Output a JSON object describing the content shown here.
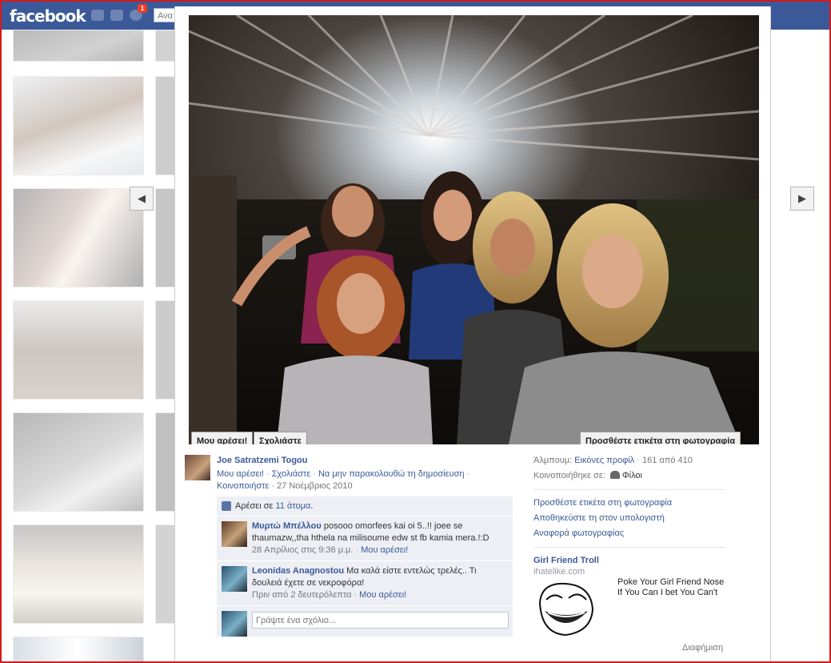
{
  "topbar": {
    "logo": "facebook",
    "notification_count": "1",
    "search_placeholder": "Ανα"
  },
  "photo": {
    "like_button": "Μου αρέσει!",
    "comment_button": "Σχολιάστε",
    "tag_button": "Προσθέστε ετικέτα στη φωτογραφία"
  },
  "post": {
    "owner_name": "Joe Satratzemi Togou",
    "actions": [
      "Μου αρέσει!",
      "Σχολιάστε",
      "Να μην παρακολουθώ τη δημοσίευση",
      "Κοινοποιήστε"
    ],
    "date": "27 Νοέμβριος 2010",
    "likes_prefix": "Αρέσει σε",
    "likes_link": "11 άτομα",
    "likes_suffix": ".",
    "comments": [
      {
        "author": "Μυρτώ Μπέλλου",
        "text": "posooo omorfees kai oi 5..!! joee se thaumazw,,tha hthela na milisoume edw st fb kamia mera.!:D",
        "time": "28 Απρίλιος στις 9:36 μ.μ.",
        "like": "Μου αρέσει!"
      },
      {
        "author": "Leonidas Anagnostou",
        "text": "Μα καλά είστε εντελώς τρελές.. Τι δουλειά έχετε σε νεκροφόρα!",
        "time": "Πριν από 2 δευτερόλεπτα",
        "like": "Μου αρέσει!"
      }
    ],
    "comment_placeholder": "Γράψτε ένα σχόλιο..."
  },
  "sidebar": {
    "album_label": "Άλμπουμ:",
    "album_name": "Εικόνες προφίλ",
    "album_position": "161 από 410",
    "shared_label": "Κοινοποιήθηκε σε:",
    "shared_value": "Φίλοι",
    "actions": [
      "Προσθέστε ετικέτα στη φωτογραφία",
      "Αποθηκεύστε τη στον υπολογιστή",
      "Αναφορά φωτογραφίας"
    ]
  },
  "ad": {
    "title": "Girl Friend Troll",
    "url": "ihatelike.com",
    "text": "Poke Your Girl Friend Nose If You Can I bet You Can't",
    "footer": "Διαφήμιση"
  },
  "colors": {
    "brand_blue": "#3b5998",
    "link_blue": "#3b5998",
    "frame_red": "#d21a1a",
    "comment_bg": "#edeff4"
  }
}
